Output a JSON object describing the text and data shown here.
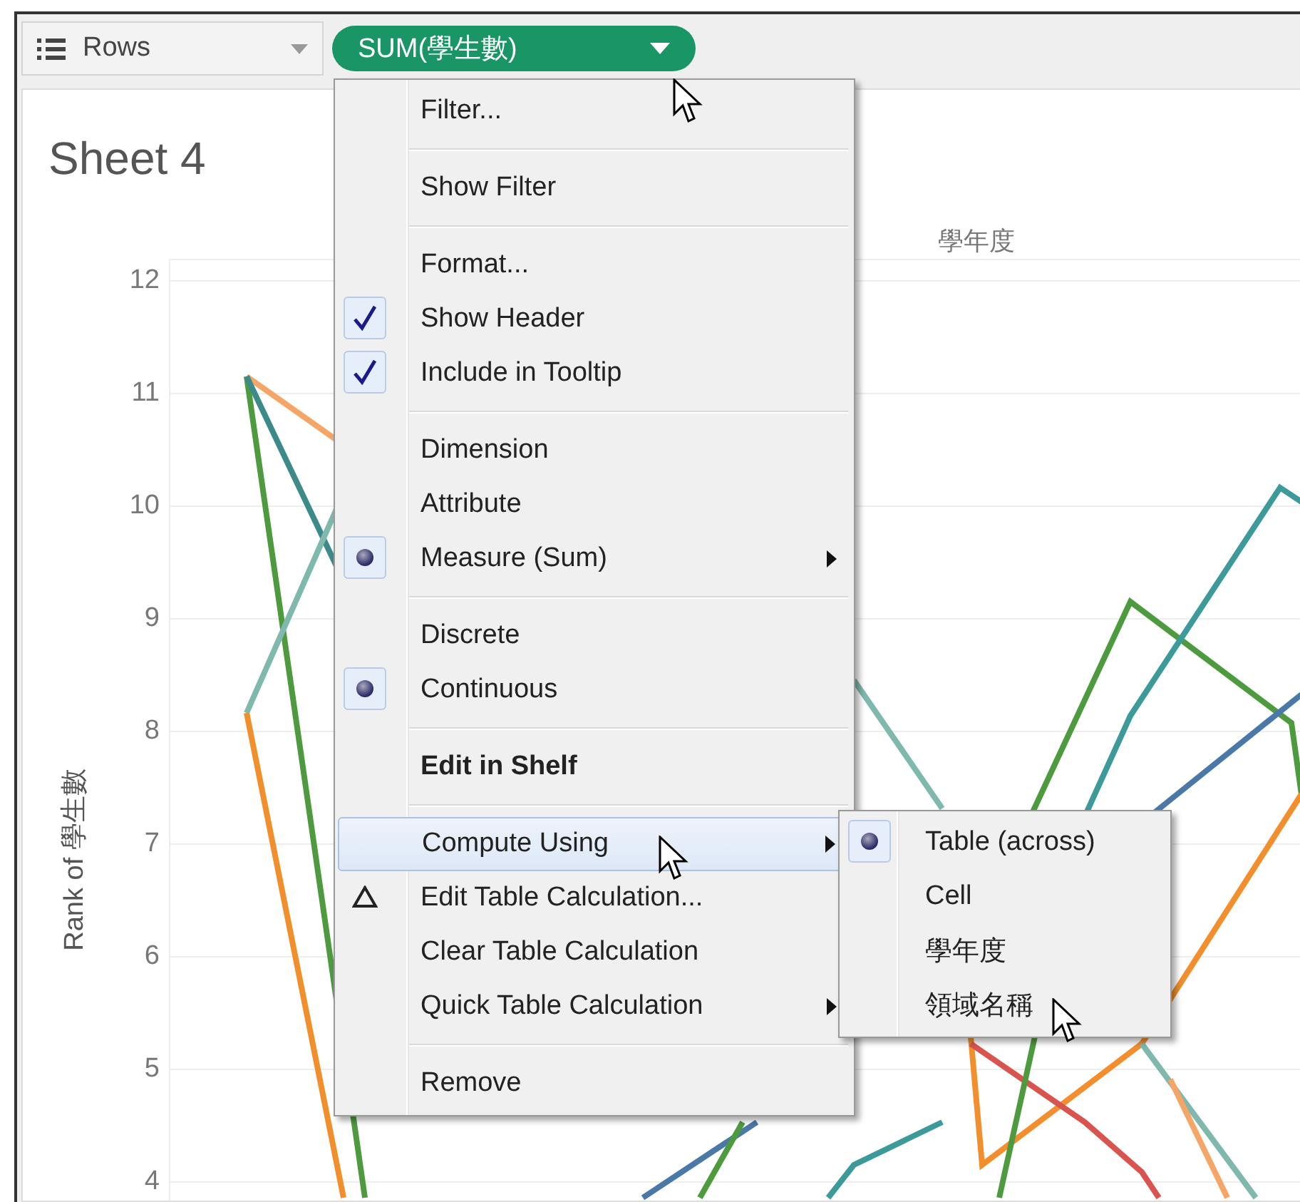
{
  "shelf": {
    "label": "Rows",
    "pill": "SUM(學生數)"
  },
  "sheet": {
    "title": "Sheet 4",
    "column_header": "學年度",
    "y_axis_title": "Rank of 學生數",
    "y_ticks": [
      "12",
      "11",
      "10",
      "9",
      "8",
      "7",
      "6",
      "5",
      "4"
    ]
  },
  "menu": {
    "sections": [
      [
        {
          "label": "Filter...",
          "kind": "plain",
          "checked": false,
          "submenu": false,
          "highlighted": false,
          "default": false
        }
      ],
      [
        {
          "label": "Show Filter",
          "kind": "plain",
          "checked": false,
          "submenu": false,
          "highlighted": false,
          "default": false
        }
      ],
      [
        {
          "label": "Format...",
          "kind": "plain",
          "checked": false,
          "submenu": false,
          "highlighted": false,
          "default": false
        },
        {
          "label": "Show Header",
          "kind": "check",
          "checked": true,
          "submenu": false,
          "highlighted": false,
          "default": false
        },
        {
          "label": "Include in Tooltip",
          "kind": "check",
          "checked": true,
          "submenu": false,
          "highlighted": false,
          "default": false
        }
      ],
      [
        {
          "label": "Dimension",
          "kind": "radio",
          "checked": false,
          "submenu": false,
          "highlighted": false,
          "default": false
        },
        {
          "label": "Attribute",
          "kind": "radio",
          "checked": false,
          "submenu": false,
          "highlighted": false,
          "default": false
        },
        {
          "label": "Measure (Sum)",
          "kind": "radio",
          "checked": true,
          "submenu": true,
          "highlighted": false,
          "default": false
        }
      ],
      [
        {
          "label": "Discrete",
          "kind": "radio",
          "checked": false,
          "submenu": false,
          "highlighted": false,
          "default": false
        },
        {
          "label": "Continuous",
          "kind": "radio",
          "checked": true,
          "submenu": false,
          "highlighted": false,
          "default": false
        }
      ],
      [
        {
          "label": "Edit in Shelf",
          "kind": "plain",
          "checked": false,
          "submenu": false,
          "highlighted": false,
          "default": true
        }
      ],
      [
        {
          "label": "Compute Using",
          "kind": "plain",
          "checked": false,
          "submenu": true,
          "highlighted": true,
          "default": false
        },
        {
          "label": "Edit Table Calculation...",
          "kind": "calc",
          "checked": false,
          "submenu": false,
          "highlighted": false,
          "default": false
        },
        {
          "label": "Clear Table Calculation",
          "kind": "plain",
          "checked": false,
          "submenu": false,
          "highlighted": false,
          "default": false
        },
        {
          "label": "Quick Table Calculation",
          "kind": "plain",
          "checked": false,
          "submenu": true,
          "highlighted": false,
          "default": false
        }
      ],
      [
        {
          "label": "Remove",
          "kind": "plain",
          "checked": false,
          "submenu": false,
          "highlighted": false,
          "default": false
        }
      ]
    ]
  },
  "submenu": {
    "items": [
      {
        "label": "Table (across)",
        "selected": true
      },
      {
        "label": "Cell",
        "selected": false
      },
      {
        "label": "學年度",
        "selected": false
      },
      {
        "label": "領域名稱",
        "selected": false
      }
    ]
  }
}
